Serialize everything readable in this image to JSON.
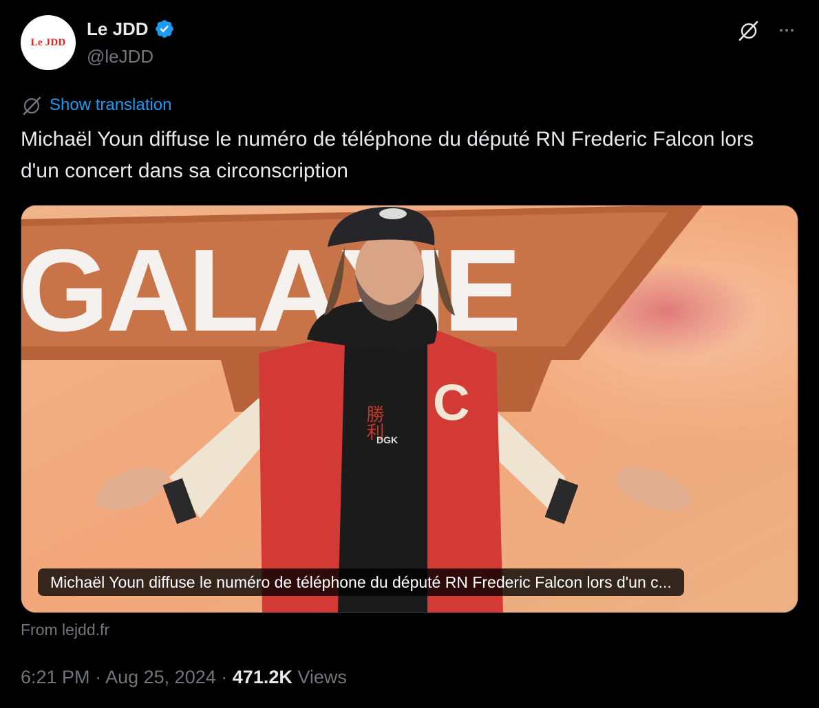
{
  "author": {
    "display_name": "Le JDD",
    "handle": "@leJDD",
    "avatar_text": "Le JDD",
    "verified": true
  },
  "translate": {
    "label": "Show translation"
  },
  "tweet": {
    "text": "Michaël Youn diffuse le numéro de téléphone du député RN Frederic Falcon lors d'un concert dans sa circonscription"
  },
  "card": {
    "title": "Michaël Youn diffuse le numéro de téléphone du député RN Frederic Falcon lors d'un c...",
    "background_text": "GALAXIE",
    "shirt_text": "勝利",
    "shirt_brand": "DGK",
    "source": "From lejdd.fr"
  },
  "meta": {
    "time": "6:21 PM",
    "date": "Aug 25, 2024",
    "separator": "·",
    "views_count": "471.2K",
    "views_label": "Views"
  },
  "colors": {
    "background": "#000000",
    "text": "#e7e9ea",
    "muted": "#71767b",
    "link": "#1d9bf0",
    "verified": "#1d9bf0",
    "brand_red": "#e2231a"
  },
  "icons": {
    "verified": "verified-badge-icon",
    "grok": "grok-icon",
    "more": "more-icon",
    "translate": "translate-icon"
  }
}
